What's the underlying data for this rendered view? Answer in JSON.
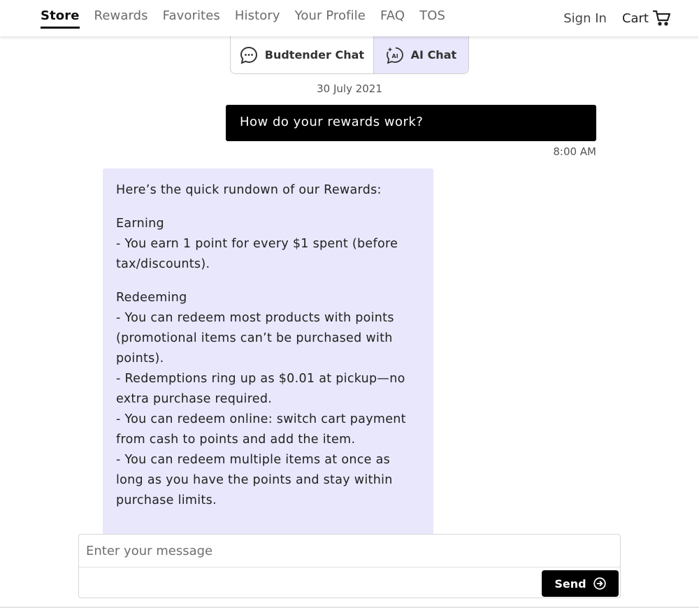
{
  "nav": {
    "links": [
      "Store",
      "Rewards",
      "Favorites",
      "History",
      "Your Profile",
      "FAQ",
      "TOS"
    ],
    "active": "Store",
    "sign_in": "Sign In",
    "cart": "Cart"
  },
  "chat_toggle": {
    "budtender_label": "Budtender Chat",
    "ai_label": "AI Chat",
    "selected": "AI Chat"
  },
  "conversation": {
    "date": "30 July 2021",
    "user_message": "How do your rewards work?",
    "user_time": "8:00 AM",
    "ai_message": {
      "intro": "Here’s the quick rundown of our Rewards:",
      "sections": [
        {
          "heading": "Earning",
          "lines": [
            "- You earn 1 point for every $1 spent (before tax/discounts)."
          ]
        },
        {
          "heading": "Redeeming",
          "lines": [
            "- You can redeem most products with points (promotional items can’t be purchased with points).",
            "- Redemptions ring up as $0.01 at pickup—no extra purchase required.",
            "- You can redeem online: switch cart payment from cash to points and add the item.",
            "- You can redeem multiple items at once as long as you have the points and stay within purchase limits."
          ]
        }
      ]
    }
  },
  "composer": {
    "placeholder": "Enter your message",
    "send_label": "Send"
  },
  "colors": {
    "accent_bg": "#e8e7fb",
    "user_bubble": "#000000",
    "send_button": "#000000"
  }
}
